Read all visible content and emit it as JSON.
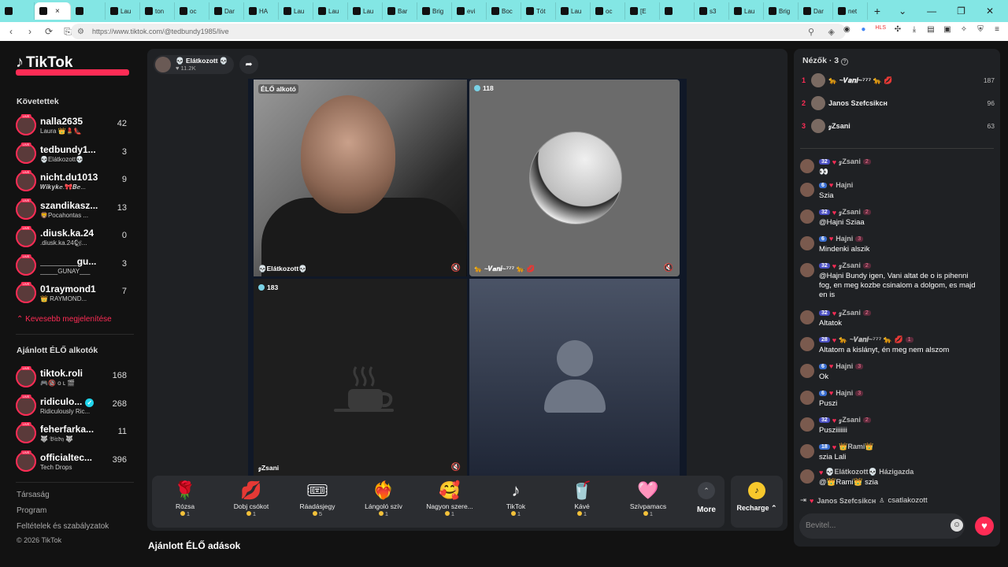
{
  "browser": {
    "tabs": [
      {
        "label": "",
        "active": false
      },
      {
        "label": "",
        "active": true
      },
      {
        "label": "",
        "active": false
      },
      {
        "label": "Lau",
        "active": false
      },
      {
        "label": "ton",
        "active": false
      },
      {
        "label": "oc",
        "active": false
      },
      {
        "label": "Dar",
        "active": false
      },
      {
        "label": "HA",
        "active": false
      },
      {
        "label": "Lau",
        "active": false
      },
      {
        "label": "Lau",
        "active": false
      },
      {
        "label": "Lau",
        "active": false
      },
      {
        "label": "Bar",
        "active": false
      },
      {
        "label": "Brig",
        "active": false
      },
      {
        "label": "evi",
        "active": false
      },
      {
        "label": "Boc",
        "active": false
      },
      {
        "label": "Tót",
        "active": false
      },
      {
        "label": "Lau",
        "active": false
      },
      {
        "label": "oc",
        "active": false
      },
      {
        "label": "[E",
        "active": false
      },
      {
        "label": "",
        "active": false
      },
      {
        "label": "s3",
        "active": false
      },
      {
        "label": "Lau",
        "active": false
      },
      {
        "label": "Brig",
        "active": false
      },
      {
        "label": "Dar",
        "active": false
      },
      {
        "label": "net",
        "active": false
      }
    ],
    "active_close": "×",
    "new_tab": "+",
    "url": "https://www.tiktok.com/@tedbundy1985/live",
    "ext_label": "HLS"
  },
  "sidebar": {
    "logo": "TikTok",
    "following_title": "Követettek",
    "following": [
      {
        "name": "nalla2635",
        "sub": "Laura 👑💄👠",
        "count": "42"
      },
      {
        "name": "tedbundy1...",
        "sub": "💀Elátkozott💀",
        "count": "3"
      },
      {
        "name": "nicht.du1013",
        "sub": "𝑾𝒊𝒌𝒚𝒌𝒆.🎀𝑩𝒆...",
        "count": "9"
      },
      {
        "name": "szandikasz...",
        "sub": "🦁Pocahontas ...",
        "count": "13"
      },
      {
        "name": ".diusk.ka.24",
        "sub": ".diusk.ka.24🐿...",
        "count": "0"
      },
      {
        "name": "_______gu...",
        "sub": "_____GUNAY___",
        "count": "3"
      },
      {
        "name": "01raymond1",
        "sub": "👑 RAYMOND...",
        "count": "7"
      }
    ],
    "show_less": "Kevesebb megjelenítése",
    "recommended_title": "Ajánlott ÉLŐ alkotók",
    "recommended": [
      {
        "name": "tiktok.roli",
        "sub": "🎮🔞 ᴏ ʟ 🎬",
        "count": "168",
        "verified": false
      },
      {
        "name": "ridiculo...",
        "sub": "Ridiculously Ric...",
        "count": "268",
        "verified": true
      },
      {
        "name": "feherfarka...",
        "sub": "🐺 𝔅𝔦𝔯𝔡𝔶 🐺",
        "count": "11",
        "verified": false
      },
      {
        "name": "officialtec...",
        "sub": "Tech Drops",
        "count": "396",
        "verified": false
      }
    ],
    "links": [
      "Társaság",
      "Program",
      "Feltételek és szabályzatok"
    ],
    "copyright": "© 2026 TikTok"
  },
  "stream": {
    "host_name": "💀 Elátkozott 💀",
    "host_likes": "♥ 11.2K",
    "cells": [
      {
        "tag": "ÉLŐ alkotó",
        "name": "💀Elátkozott💀",
        "viewers": ""
      },
      {
        "tag": "",
        "name": "🐆 ~𝑽𝒂𝒏𝒊~⁷⁷⁷ 🐆 💋",
        "viewers": "118"
      },
      {
        "tag": "",
        "name": "𝓏Zsani",
        "viewers": "183"
      },
      {
        "tag": "",
        "name": "",
        "viewers": ""
      }
    ],
    "mute_glyph": "🔇"
  },
  "gifts": [
    {
      "name": "Rózsa",
      "icon": "🌹",
      "price": "1"
    },
    {
      "name": "Dobj csókot",
      "icon": "💋",
      "price": "1"
    },
    {
      "name": "Ráadásjegy",
      "icon": "🎟",
      "price": "5"
    },
    {
      "name": "Lángoló szív",
      "icon": "❤️‍🔥",
      "price": "1"
    },
    {
      "name": "Nagyon szere...",
      "icon": "🥰",
      "price": "1"
    },
    {
      "name": "TikTok",
      "icon": "♪",
      "price": "1"
    },
    {
      "name": "Kávé",
      "icon": "🥤",
      "price": "1"
    },
    {
      "name": "Szívpamacs",
      "icon": "🩷",
      "price": "1"
    }
  ],
  "more_label": "More",
  "recharge_label": "Recharge ⌃",
  "recommended_streams_title": "Ajánlott ÉLŐ adások",
  "chat": {
    "viewers_title": "Nézők · 3",
    "top_viewers": [
      {
        "rank": "1",
        "name": "🐆 ~𝑽𝒂𝒏𝒊~⁷⁷⁷ 🐆 💋",
        "score": "187"
      },
      {
        "rank": "2",
        "name": "Janos Szefcsikсн",
        "score": "96"
      },
      {
        "rank": "3",
        "name": "𝓏Zsani",
        "score": "63"
      }
    ],
    "messages": [
      {
        "level": "32",
        "name": "𝓏Zsani",
        "fan": "2",
        "text": "👀"
      },
      {
        "level": "6",
        "name": "Hajni",
        "fan": "",
        "text": "Szia"
      },
      {
        "level": "32",
        "name": "𝓏Zsani",
        "fan": "2",
        "text": "@Hajni Sziaa"
      },
      {
        "level": "6",
        "name": "Hajni",
        "fan": "3",
        "text": "Mindenki alszik"
      },
      {
        "level": "32",
        "name": "𝓏Zsani",
        "fan": "2",
        "text": "@Hajni Bundy igen, Vani altat de o is pihenni fog, en meg kozbe csinalom a dolgom, es majd en is"
      },
      {
        "level": "32",
        "name": "𝓏Zsani",
        "fan": "2",
        "text": "Altatok"
      },
      {
        "level": "28",
        "name": "🐆 ~𝑽𝒂𝒏𝒊~⁷⁷⁷ 🐆 💋",
        "fan": "1",
        "text": "Altatom a kislányt, én meg nem alszom"
      },
      {
        "level": "6",
        "name": "Hajni",
        "fan": "3",
        "text": "Ok"
      },
      {
        "level": "6",
        "name": "Hajni",
        "fan": "3",
        "text": "Puszi"
      },
      {
        "level": "32",
        "name": "𝓏Zsani",
        "fan": "2",
        "text": "Pusziiiiiii"
      },
      {
        "level": "18",
        "name": "👑Rami👑",
        "fan": "",
        "text": "szia Lali"
      },
      {
        "level": "",
        "name": "💀Elátkozott💀 Házigazda",
        "fan": "",
        "text": "@👑Rami👑 szia"
      }
    ],
    "joined_name": "Janos Szefcsikсн",
    "joined_text": "csatlakozott",
    "input_placeholder": "Bevitel..."
  }
}
